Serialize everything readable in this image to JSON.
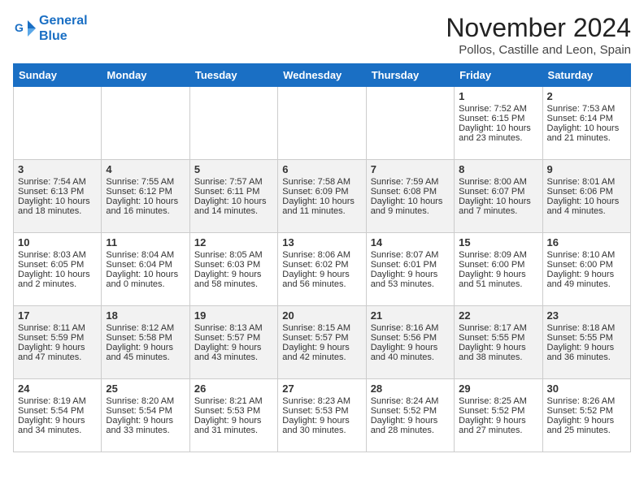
{
  "logo": {
    "line1": "General",
    "line2": "Blue"
  },
  "title": "November 2024",
  "location": "Pollos, Castille and Leon, Spain",
  "days_of_week": [
    "Sunday",
    "Monday",
    "Tuesday",
    "Wednesday",
    "Thursday",
    "Friday",
    "Saturday"
  ],
  "weeks": [
    [
      {
        "day": "",
        "info": ""
      },
      {
        "day": "",
        "info": ""
      },
      {
        "day": "",
        "info": ""
      },
      {
        "day": "",
        "info": ""
      },
      {
        "day": "",
        "info": ""
      },
      {
        "day": "1",
        "info": "Sunrise: 7:52 AM\nSunset: 6:15 PM\nDaylight: 10 hours\nand 23 minutes."
      },
      {
        "day": "2",
        "info": "Sunrise: 7:53 AM\nSunset: 6:14 PM\nDaylight: 10 hours\nand 21 minutes."
      }
    ],
    [
      {
        "day": "3",
        "info": "Sunrise: 7:54 AM\nSunset: 6:13 PM\nDaylight: 10 hours\nand 18 minutes."
      },
      {
        "day": "4",
        "info": "Sunrise: 7:55 AM\nSunset: 6:12 PM\nDaylight: 10 hours\nand 16 minutes."
      },
      {
        "day": "5",
        "info": "Sunrise: 7:57 AM\nSunset: 6:11 PM\nDaylight: 10 hours\nand 14 minutes."
      },
      {
        "day": "6",
        "info": "Sunrise: 7:58 AM\nSunset: 6:09 PM\nDaylight: 10 hours\nand 11 minutes."
      },
      {
        "day": "7",
        "info": "Sunrise: 7:59 AM\nSunset: 6:08 PM\nDaylight: 10 hours\nand 9 minutes."
      },
      {
        "day": "8",
        "info": "Sunrise: 8:00 AM\nSunset: 6:07 PM\nDaylight: 10 hours\nand 7 minutes."
      },
      {
        "day": "9",
        "info": "Sunrise: 8:01 AM\nSunset: 6:06 PM\nDaylight: 10 hours\nand 4 minutes."
      }
    ],
    [
      {
        "day": "10",
        "info": "Sunrise: 8:03 AM\nSunset: 6:05 PM\nDaylight: 10 hours\nand 2 minutes."
      },
      {
        "day": "11",
        "info": "Sunrise: 8:04 AM\nSunset: 6:04 PM\nDaylight: 10 hours\nand 0 minutes."
      },
      {
        "day": "12",
        "info": "Sunrise: 8:05 AM\nSunset: 6:03 PM\nDaylight: 9 hours\nand 58 minutes."
      },
      {
        "day": "13",
        "info": "Sunrise: 8:06 AM\nSunset: 6:02 PM\nDaylight: 9 hours\nand 56 minutes."
      },
      {
        "day": "14",
        "info": "Sunrise: 8:07 AM\nSunset: 6:01 PM\nDaylight: 9 hours\nand 53 minutes."
      },
      {
        "day": "15",
        "info": "Sunrise: 8:09 AM\nSunset: 6:00 PM\nDaylight: 9 hours\nand 51 minutes."
      },
      {
        "day": "16",
        "info": "Sunrise: 8:10 AM\nSunset: 6:00 PM\nDaylight: 9 hours\nand 49 minutes."
      }
    ],
    [
      {
        "day": "17",
        "info": "Sunrise: 8:11 AM\nSunset: 5:59 PM\nDaylight: 9 hours\nand 47 minutes."
      },
      {
        "day": "18",
        "info": "Sunrise: 8:12 AM\nSunset: 5:58 PM\nDaylight: 9 hours\nand 45 minutes."
      },
      {
        "day": "19",
        "info": "Sunrise: 8:13 AM\nSunset: 5:57 PM\nDaylight: 9 hours\nand 43 minutes."
      },
      {
        "day": "20",
        "info": "Sunrise: 8:15 AM\nSunset: 5:57 PM\nDaylight: 9 hours\nand 42 minutes."
      },
      {
        "day": "21",
        "info": "Sunrise: 8:16 AM\nSunset: 5:56 PM\nDaylight: 9 hours\nand 40 minutes."
      },
      {
        "day": "22",
        "info": "Sunrise: 8:17 AM\nSunset: 5:55 PM\nDaylight: 9 hours\nand 38 minutes."
      },
      {
        "day": "23",
        "info": "Sunrise: 8:18 AM\nSunset: 5:55 PM\nDaylight: 9 hours\nand 36 minutes."
      }
    ],
    [
      {
        "day": "24",
        "info": "Sunrise: 8:19 AM\nSunset: 5:54 PM\nDaylight: 9 hours\nand 34 minutes."
      },
      {
        "day": "25",
        "info": "Sunrise: 8:20 AM\nSunset: 5:54 PM\nDaylight: 9 hours\nand 33 minutes."
      },
      {
        "day": "26",
        "info": "Sunrise: 8:21 AM\nSunset: 5:53 PM\nDaylight: 9 hours\nand 31 minutes."
      },
      {
        "day": "27",
        "info": "Sunrise: 8:23 AM\nSunset: 5:53 PM\nDaylight: 9 hours\nand 30 minutes."
      },
      {
        "day": "28",
        "info": "Sunrise: 8:24 AM\nSunset: 5:52 PM\nDaylight: 9 hours\nand 28 minutes."
      },
      {
        "day": "29",
        "info": "Sunrise: 8:25 AM\nSunset: 5:52 PM\nDaylight: 9 hours\nand 27 minutes."
      },
      {
        "day": "30",
        "info": "Sunrise: 8:26 AM\nSunset: 5:52 PM\nDaylight: 9 hours\nand 25 minutes."
      }
    ]
  ]
}
